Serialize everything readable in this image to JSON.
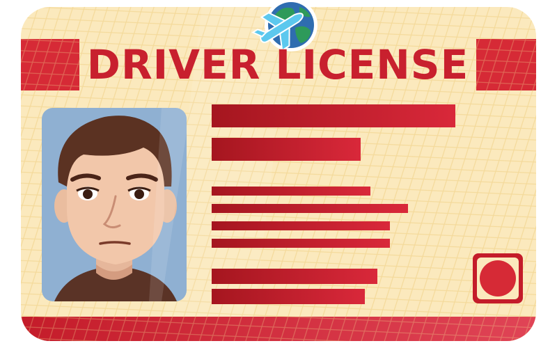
{
  "card": {
    "title": "DRIVER LICENSE"
  },
  "icons": {
    "top_emblem": "globe-airplane-icon",
    "portrait": "person-portrait-icon",
    "seal": "seal-stamp-icon"
  },
  "colors": {
    "card_fill": "#fbe9bd",
    "accent_red": "#d62a36",
    "dark_red": "#a5161f",
    "photo_bg": "#8fb0d2",
    "text_red": "#c8202e"
  }
}
